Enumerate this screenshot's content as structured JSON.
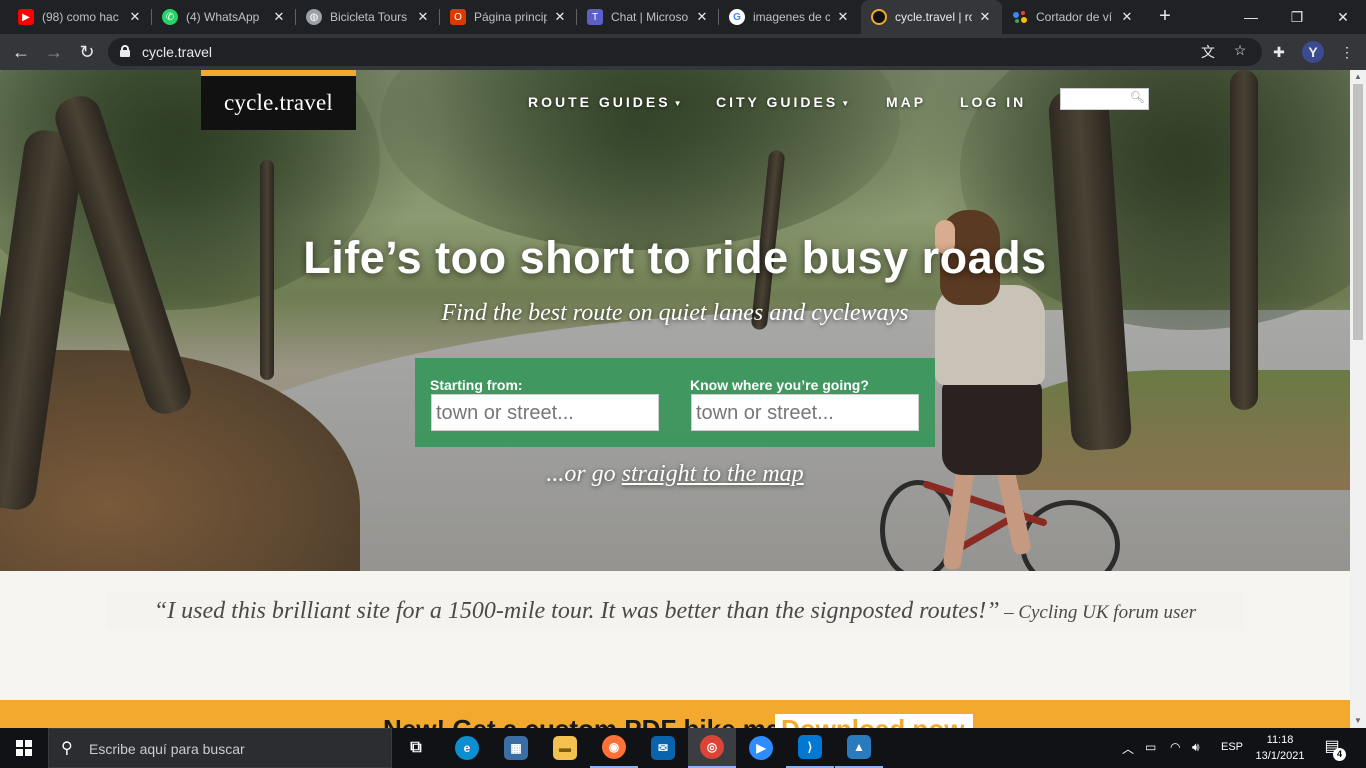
{
  "browser": {
    "tabs": [
      {
        "title": "(98) como hac",
        "icon": "youtube-icon",
        "color": "#ff0000"
      },
      {
        "title": "(4) WhatsApp",
        "icon": "whatsapp-icon",
        "color": "#25d366"
      },
      {
        "title": "Bicicleta Tours",
        "icon": "globe-icon",
        "color": "#9aa0a6"
      },
      {
        "title": "Página princip",
        "icon": "office-icon",
        "color": "#d83b01"
      },
      {
        "title": "Chat | Microso",
        "icon": "teams-icon",
        "color": "#5b5fc7"
      },
      {
        "title": "imagenes de c",
        "icon": "google-icon",
        "color": "#4285f4"
      },
      {
        "title": "cycle.travel | ro",
        "icon": "cycle-travel-icon",
        "color": "#f3a92d"
      },
      {
        "title": "Cortador de ví",
        "icon": "assistant-icon",
        "color": "#4285f4"
      }
    ],
    "active_tab_index": 6,
    "url": "cycle.travel"
  },
  "site": {
    "logo_text": "cycle.travel",
    "nav": {
      "route_guides": "ROUTE GUIDES",
      "city_guides": "CITY GUIDES",
      "map": "MAP",
      "login": "LOG IN"
    },
    "headline": "Life’s too short to ride busy roads",
    "subheadline": "Find the best route on quiet lanes and cycleways",
    "planner": {
      "start_label": "Starting from:",
      "start_placeholder": "town or street...",
      "dest_label": "Know where you’re going?",
      "dest_placeholder": "town or street..."
    },
    "go_prefix": "...or go ",
    "go_link": "straight to the map",
    "quote": "“I used this brilliant site for a 1500-mile tour. It was better than the signposted routes!”",
    "quote_attribution": "– Cycling UK forum user",
    "promo_text": "New! Get a custom PDF bike map",
    "promo_button": "Download now"
  },
  "taskbar": {
    "search_placeholder": "Escribe aquí para buscar",
    "apps": [
      {
        "name": "task-view-icon",
        "label": "⧉",
        "color": "transparent"
      },
      {
        "name": "edge-icon",
        "label": "e",
        "color": "#0c8fd1"
      },
      {
        "name": "store-icon",
        "label": "▦",
        "color": "#3a6ea5"
      },
      {
        "name": "file-explorer-icon",
        "label": "▬",
        "color": "#f2c14e"
      },
      {
        "name": "firefox-icon",
        "label": "◉",
        "color": "#ff7139"
      },
      {
        "name": "mail-icon",
        "label": "✉",
        "color": "#0a64ad"
      },
      {
        "name": "chrome-icon",
        "label": "◎",
        "color": "#db4437"
      },
      {
        "name": "zoom-icon",
        "label": "▶",
        "color": "#2d8cff"
      },
      {
        "name": "vscode-icon",
        "label": "⟩",
        "color": "#0078d4"
      },
      {
        "name": "photos-icon",
        "label": "▲",
        "color": "#2a7ac0"
      }
    ],
    "language": "ESP",
    "time": "11:18",
    "date": "13/1/2021",
    "notification_count": "4"
  }
}
